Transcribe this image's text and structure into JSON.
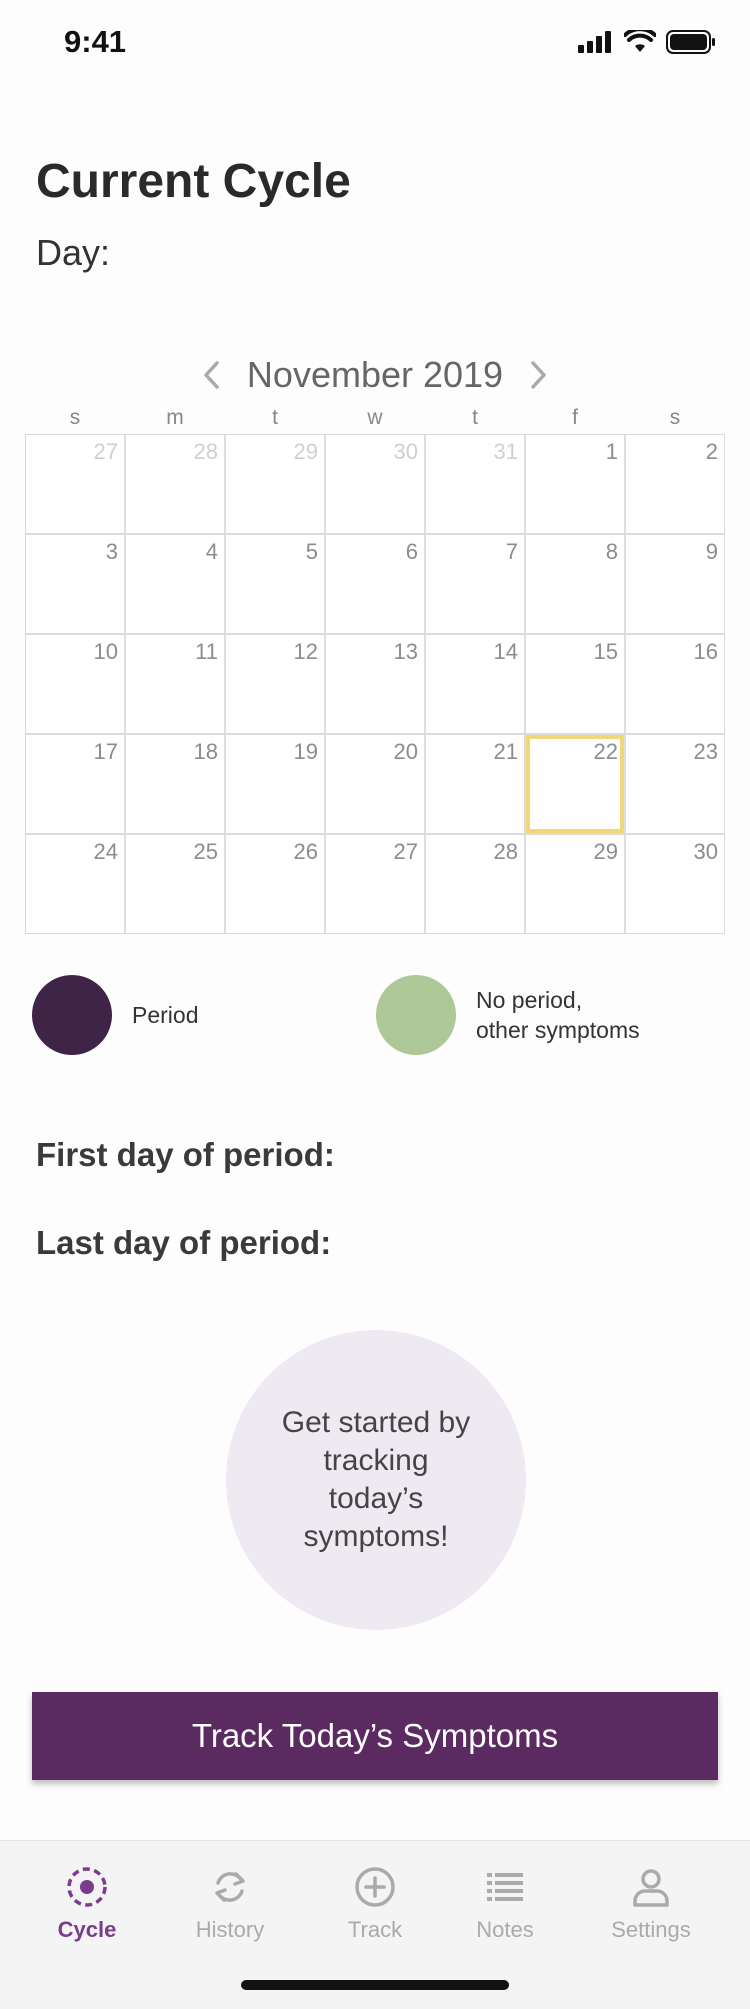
{
  "status": {
    "time": "9:41",
    "icons": [
      "signal-icon",
      "wifi-icon",
      "battery-icon"
    ]
  },
  "header": {
    "title": "Current Cycle",
    "day_label": "Day:"
  },
  "calendar": {
    "month_label": "November 2019",
    "weekdays": [
      "s",
      "m",
      "t",
      "w",
      "t",
      "f",
      "s"
    ],
    "weeks": [
      [
        {
          "d": "27",
          "other": true
        },
        {
          "d": "28",
          "other": true
        },
        {
          "d": "29",
          "other": true
        },
        {
          "d": "30",
          "other": true
        },
        {
          "d": "31",
          "other": true
        },
        {
          "d": "1"
        },
        {
          "d": "2"
        }
      ],
      [
        {
          "d": "3"
        },
        {
          "d": "4"
        },
        {
          "d": "5"
        },
        {
          "d": "6"
        },
        {
          "d": "7"
        },
        {
          "d": "8"
        },
        {
          "d": "9"
        }
      ],
      [
        {
          "d": "10"
        },
        {
          "d": "11"
        },
        {
          "d": "12"
        },
        {
          "d": "13"
        },
        {
          "d": "14"
        },
        {
          "d": "15"
        },
        {
          "d": "16"
        }
      ],
      [
        {
          "d": "17"
        },
        {
          "d": "18"
        },
        {
          "d": "19"
        },
        {
          "d": "20"
        },
        {
          "d": "21"
        },
        {
          "d": "22",
          "today": true
        },
        {
          "d": "23"
        }
      ],
      [
        {
          "d": "24"
        },
        {
          "d": "25"
        },
        {
          "d": "26"
        },
        {
          "d": "27"
        },
        {
          "d": "28"
        },
        {
          "d": "29"
        },
        {
          "d": "30"
        }
      ]
    ],
    "today_color": "#f1d77a"
  },
  "legend": {
    "period": {
      "label": "Period",
      "color": "#3e2446"
    },
    "other": {
      "label_line1": "No period,",
      "label_line2": "other symptoms",
      "color": "#adc797"
    }
  },
  "period_info": {
    "first_day_label": "First day of period:",
    "last_day_label": "Last day of period:"
  },
  "prompt": {
    "line1": "Get started by",
    "line2": "tracking",
    "line3": "today’s",
    "line4": "symptoms!"
  },
  "cta": {
    "label": "Track Today’s Symptoms",
    "color": "#5b2a61"
  },
  "tabs": [
    {
      "label": "Cycle",
      "icon": "cycle-icon",
      "active": true
    },
    {
      "label": "History",
      "icon": "history-icon"
    },
    {
      "label": "Track",
      "icon": "track-plus-icon"
    },
    {
      "label": "Notes",
      "icon": "notes-list-icon"
    },
    {
      "label": "Settings",
      "icon": "settings-person-icon"
    }
  ],
  "accent_color": "#7b3c8d"
}
